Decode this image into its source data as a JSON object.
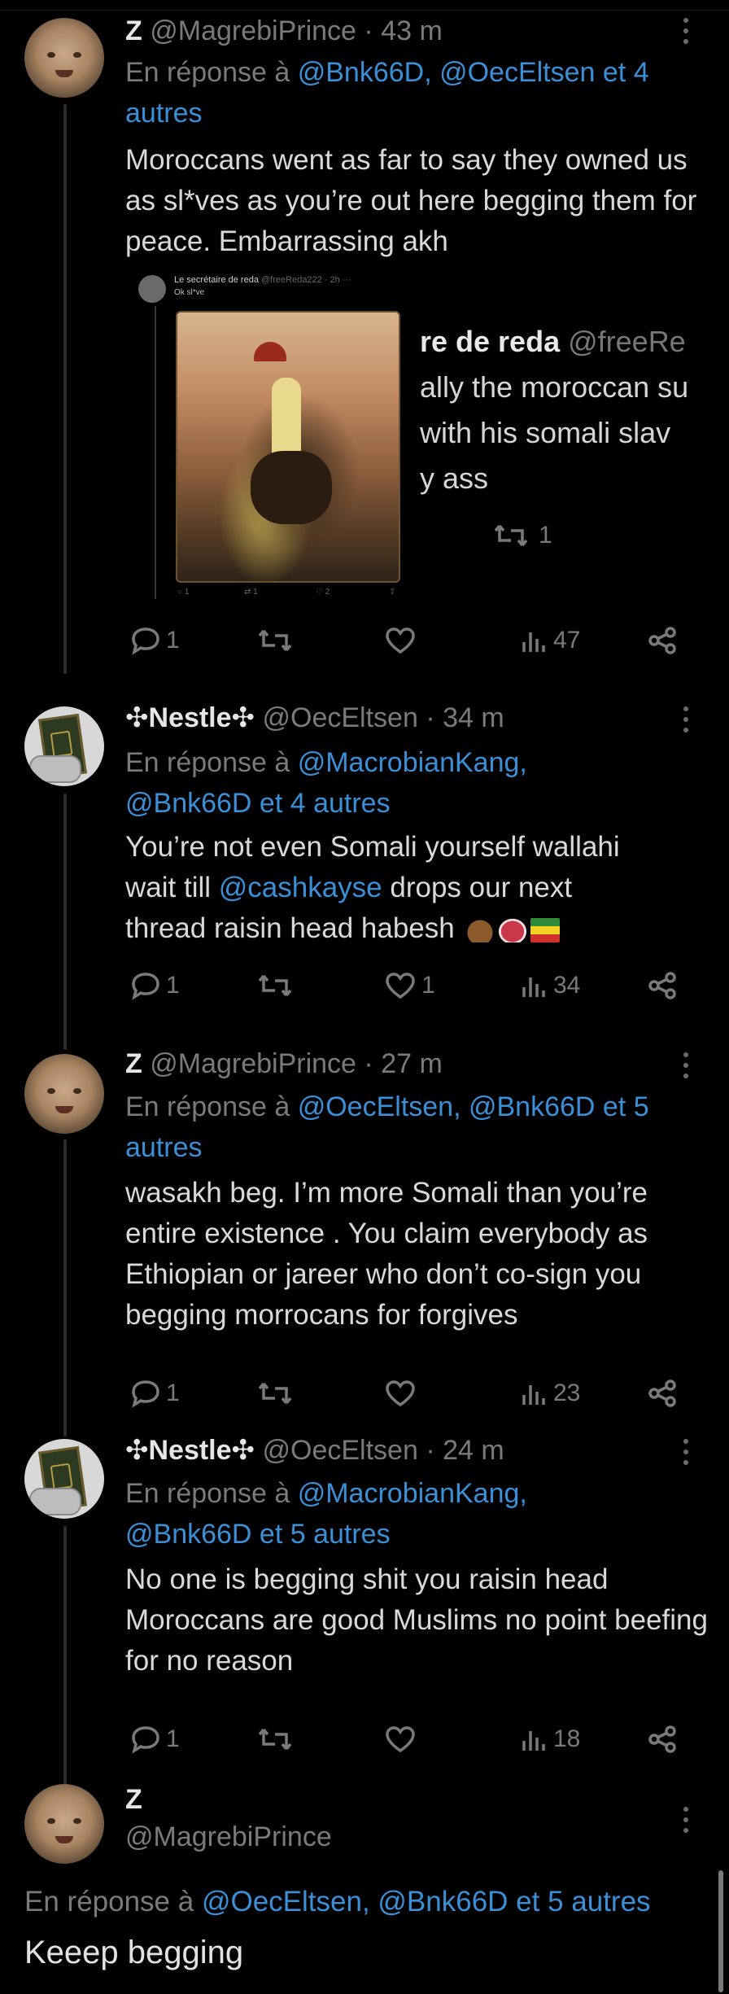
{
  "tweets": [
    {
      "name": "Z",
      "handle": "@MagrebiPrince",
      "time": "· 43 m",
      "reply_prefix": "En réponse à",
      "reply_targets": "@Bnk66D, @OecEltsen et 4 autres",
      "body": "Moroccans went as far to say they owned us as sl*ves as you’re out here begging them for peace. Embarrassing akh",
      "quote": {
        "name": "Le secrétaire de reda",
        "handle": "@freeReda222 · 2h",
        "text": "Ok sl*ve",
        "big_name": "re de reda",
        "big_handle": "@freeRe",
        "big_lines": [
          "ally the moroccan su",
          "with his somali slav",
          "y ass"
        ],
        "retweets": "1"
      },
      "replies": "1",
      "retweets": "",
      "likes": "",
      "views": "47"
    },
    {
      "name": "✣Nestle✣",
      "handle": "@OecEltsen",
      "time": "· 34 m",
      "reply_prefix": "En réponse à",
      "reply_line1": "@MacrobianKang,",
      "reply_line2": "@Bnk66D et 4 autres",
      "body_line1": "You’re not even Somali yourself wallahi",
      "body_line2_pre": "wait till ",
      "body_line2_mention": "@cashkayse",
      "body_line2_post": " drops our next",
      "body_line3": "thread raisin head habesh",
      "replies": "1",
      "retweets": "",
      "likes": "1",
      "views": "34"
    },
    {
      "name": "Z",
      "handle": "@MagrebiPrince",
      "time": "· 27 m",
      "reply_prefix": "En réponse à",
      "reply_targets": "@OecEltsen, @Bnk66D et 5 autres",
      "body": "wasakh beg. I’m more Somali than you’re entire existence . You claim everybody as Ethiopian or jareer who don’t co-sign you begging morrocans for forgives",
      "replies": "1",
      "retweets": "",
      "likes": "",
      "views": "23"
    },
    {
      "name": "✣Nestle✣",
      "handle": "@OecEltsen",
      "time": "· 24 m",
      "reply_prefix": "En réponse à",
      "reply_line1": "@MacrobianKang,",
      "reply_line2": "@Bnk66D et 5 autres",
      "body": "No one is begging shit you raisin head Moroccans are good Muslims no point beefing for no reason",
      "replies": "1",
      "retweets": "",
      "likes": "",
      "views": "18"
    }
  ],
  "focus_tweet": {
    "name": "Z",
    "handle": "@MagrebiPrince",
    "reply_prefix": "En réponse à",
    "reply_targets": "@OecEltsen, @Bnk66D et 5 autres",
    "body": "Keeep begging"
  }
}
